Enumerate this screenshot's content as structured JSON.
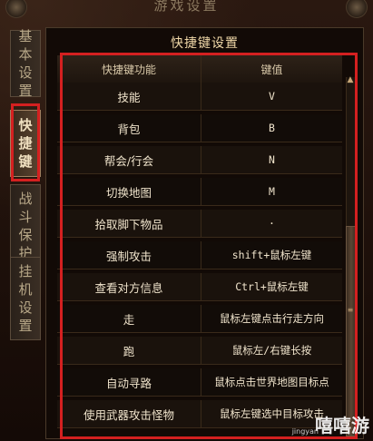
{
  "window": {
    "title": "游戏设置"
  },
  "tabs": [
    {
      "label": [
        "基",
        "本",
        "设",
        "置"
      ],
      "active": false
    },
    {
      "label": [
        "快",
        "捷",
        "键"
      ],
      "active": true
    },
    {
      "label": [
        "战",
        "斗",
        "保",
        "护"
      ],
      "active": false
    },
    {
      "label": [
        "挂",
        "机",
        "设",
        "置"
      ],
      "active": false
    }
  ],
  "panel": {
    "title": "快捷键设置"
  },
  "table": {
    "headers": [
      "快捷键功能",
      "键值"
    ],
    "rows": [
      [
        "技能",
        "V"
      ],
      [
        "背包",
        "B"
      ],
      [
        "帮会/行会",
        "N"
      ],
      [
        "切换地图",
        "M"
      ],
      [
        "拾取脚下物品",
        "·"
      ],
      [
        "强制攻击",
        "shift+鼠标左键"
      ],
      [
        "查看对方信息",
        "Ctrl+鼠标左键"
      ],
      [
        "走",
        "鼠标左键点击行走方向"
      ],
      [
        "跑",
        "鼠标左/右键长按"
      ],
      [
        "自动寻路",
        "鼠标点击世界地图目标点"
      ],
      [
        "使用武器攻击怪物",
        "鼠标左键选中目标攻击"
      ]
    ]
  },
  "scroll": {
    "up_glyph": "▲",
    "grip_glyph": "≡"
  },
  "watermark": {
    "text": "嘻嘻游",
    "sub": "jingyan"
  },
  "colors": {
    "highlight": "#d42020",
    "accent": "#f0d8a8"
  }
}
